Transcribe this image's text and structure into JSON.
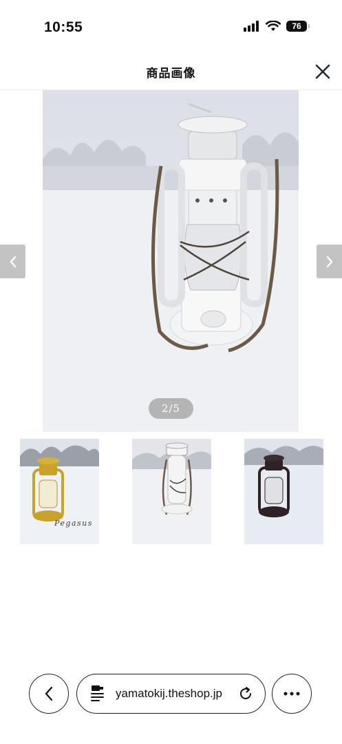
{
  "status_bar": {
    "time": "10:55",
    "battery": "76"
  },
  "header": {
    "title": "商品画像"
  },
  "gallery": {
    "counter": "2/5",
    "thumbnails": [
      {
        "caption": "Pegasus",
        "lantern_color": "#c9a227"
      },
      {
        "caption": "",
        "lantern_color": "#f2f2f2"
      },
      {
        "caption": "",
        "lantern_color": "#2e2226"
      }
    ]
  },
  "browser": {
    "url": "yamatokij.theshop.jp"
  },
  "icons": [
    "signal-icon",
    "wifi-icon",
    "battery-icon",
    "close-icon",
    "chevron-left-icon",
    "chevron-right-icon",
    "back-icon",
    "page-icon",
    "reload-icon",
    "more-icon"
  ]
}
